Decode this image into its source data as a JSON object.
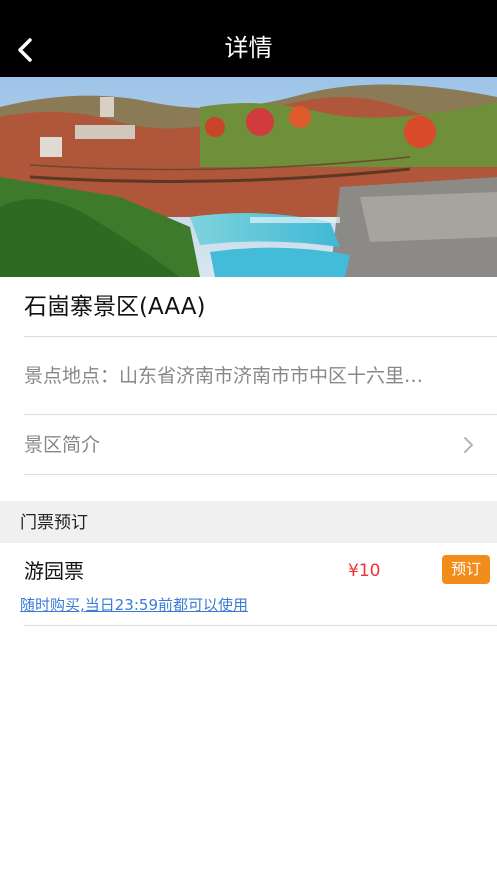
{
  "navbar": {
    "title": "详情",
    "back_icon": "chevron-left-icon"
  },
  "scenic": {
    "name": "石崮寨景区(AAA)",
    "location": "景点地点：山东省济南市济南市市中区十六里…",
    "intro_label": "景区简介"
  },
  "tickets": {
    "section_title": "门票预订",
    "items": [
      {
        "name": "游园票",
        "price": "¥10",
        "book_label": "预订",
        "note": "随时购买,当日23:59前都可以使用"
      }
    ]
  },
  "colors": {
    "navbar_bg": "#000000",
    "price": "#ee3333",
    "book_button": "#f28c1b",
    "link": "#3a7bd5",
    "section_bg": "#f0f0f0"
  }
}
